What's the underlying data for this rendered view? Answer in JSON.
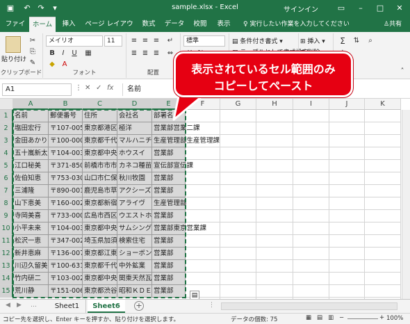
{
  "titlebar": {
    "title": "sample.xlsx - Excel",
    "signin": "サインイン",
    "save_icon": "save-icon",
    "undo_icon": "undo-icon",
    "redo_icon": "redo-icon"
  },
  "tabs": [
    "ファイル",
    "ホーム",
    "挿入",
    "ページ レイアウト",
    "数式",
    "データ",
    "校閲",
    "表示"
  ],
  "active_tab": "ホーム",
  "tell_me": "実行したい作業を入力してください",
  "share": "共有",
  "ribbon": {
    "paste": "貼り付け",
    "font_name": "メイリオ",
    "font_size": "11",
    "number_format": "標準",
    "conditional_format": "条件付き書式",
    "table_format": "テーブルとして書式設定",
    "insert": "挿入",
    "delete": "削除",
    "groups": [
      "クリップボード",
      "フォント",
      "配置"
    ]
  },
  "formula_bar": {
    "name_box": "A1",
    "formula": "名前"
  },
  "columns": [
    "A",
    "B",
    "C",
    "D",
    "E",
    "F",
    "G",
    "H",
    "I",
    "J",
    "K"
  ],
  "rows": [
    [
      "名前",
      "郵便番号",
      "住所",
      "会社名",
      "部署名"
    ],
    [
      "塩田宏行",
      "〒107-005",
      "東京都港区",
      "極洋",
      "営業部営業二課"
    ],
    [
      "金田あかり",
      "〒100-000",
      "東京都千代",
      "マルハニチ",
      "生産管理部生産管理課"
    ],
    [
      "五十嵐新太",
      "〒104-003",
      "東京都中央",
      "ホウスイ",
      "営業部"
    ],
    [
      "江口秘美",
      "〒371-850",
      "前橋市市市",
      "カネコ種苗",
      "宣伝部宣伝課"
    ],
    [
      "佐伯知恵",
      "〒753-030",
      "山口市仁保",
      "秋川牧園",
      "営業部"
    ],
    [
      "三浦隆",
      "〒890-001",
      "鹿児島市草",
      "アクシーズ",
      "営業部"
    ],
    [
      "山下恵美",
      "〒160-002",
      "東京都新宿",
      "アライヴ",
      "生産管理部"
    ],
    [
      "寺岡美喜",
      "〒733-000",
      "広島市西区",
      "ウエストホ",
      "営業部"
    ],
    [
      "小平未来",
      "〒104-003",
      "東京都中央",
      "サムシング",
      "営業部東京営業課"
    ],
    [
      "松沢一恵",
      "〒347-002",
      "埼玉県加須",
      "検索住宅",
      "営業部"
    ],
    [
      "新井恵麻",
      "〒136-007",
      "東京都江東",
      "ショーボン",
      "営業部"
    ],
    [
      "川辺久留美",
      "〒100-631",
      "東京都千代",
      "中外鉱業",
      "営業部"
    ],
    [
      "竹内研二",
      "〒103-002",
      "東京都中央",
      "関東天然瓦",
      "営業部"
    ],
    [
      "荒川静",
      "〒151-006",
      "東京都渋谷",
      "昭和ＫＤＥ",
      "営業部"
    ],
    [
      "",
      "",
      "",
      "",
      ""
    ]
  ],
  "callout": {
    "line1": "表示されているセル範囲のみ",
    "line2": "コピーしてペースト"
  },
  "sheets": [
    "Sheet1",
    "Sheet6"
  ],
  "active_sheet": "Sheet6",
  "status": {
    "message": "コピー先を選択し、Enter キーを押すか、貼り付けを選択します。",
    "count": "データの個数: 75",
    "zoom": "100%"
  }
}
